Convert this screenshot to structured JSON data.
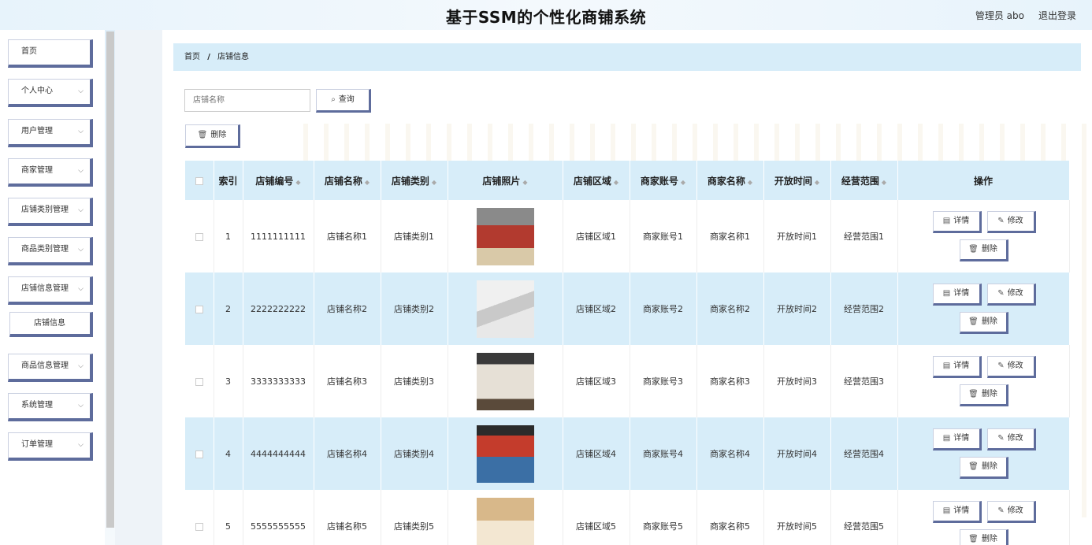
{
  "header": {
    "title": "基于SSM的个性化商铺系统",
    "user": "管理员 abo",
    "logout": "退出登录"
  },
  "sidebar": {
    "items": [
      {
        "label": "首页",
        "chevron": ""
      },
      {
        "label": "个人中心",
        "chevron": "⌵"
      },
      {
        "label": "用户管理",
        "chevron": "⌵"
      },
      {
        "label": "商家管理",
        "chevron": "⌵"
      },
      {
        "label": "店铺类别管理",
        "chevron": "⌵"
      },
      {
        "label": "商品类别管理",
        "chevron": "⌵"
      },
      {
        "label": "店铺信息管理",
        "chevron": "⌵"
      },
      {
        "label": "店铺信息",
        "chevron": ""
      },
      {
        "label": "商品信息管理",
        "chevron": "⌵"
      },
      {
        "label": "系统管理",
        "chevron": "⌵"
      },
      {
        "label": "订单管理",
        "chevron": "⌵"
      }
    ]
  },
  "breadcrumb": {
    "home": "首页",
    "sep": "/",
    "current": "店铺信息"
  },
  "search": {
    "placeholder": "店铺名称",
    "query_label": "查询",
    "query_icon": "search-icon"
  },
  "toolbar": {
    "delete_label": "删除",
    "delete_icon": "trash-icon"
  },
  "table": {
    "columns": [
      "",
      "索引",
      "店铺编号",
      "店铺名称",
      "店铺类别",
      "店铺照片",
      "店铺区域",
      "商家账号",
      "商家名称",
      "开放时间",
      "经营范围",
      "操作"
    ],
    "actions": {
      "detail": "详情",
      "edit": "修改",
      "delete": "删除"
    },
    "rows": [
      {
        "index": "1",
        "code": "1111111111",
        "name": "店铺名称1",
        "category": "店铺类别1",
        "area": "店铺区域1",
        "account": "商家账号1",
        "merchant": "商家名称1",
        "hours": "开放时间1",
        "scope": "经营范围1"
      },
      {
        "index": "2",
        "code": "2222222222",
        "name": "店铺名称2",
        "category": "店铺类别2",
        "area": "店铺区域2",
        "account": "商家账号2",
        "merchant": "商家名称2",
        "hours": "开放时间2",
        "scope": "经营范围2"
      },
      {
        "index": "3",
        "code": "3333333333",
        "name": "店铺名称3",
        "category": "店铺类别3",
        "area": "店铺区域3",
        "account": "商家账号3",
        "merchant": "商家名称3",
        "hours": "开放时间3",
        "scope": "经营范围3"
      },
      {
        "index": "4",
        "code": "4444444444",
        "name": "店铺名称4",
        "category": "店铺类别4",
        "area": "店铺区域4",
        "account": "商家账号4",
        "merchant": "商家名称4",
        "hours": "开放时间4",
        "scope": "经营范围4"
      },
      {
        "index": "5",
        "code": "5555555555",
        "name": "店铺名称5",
        "category": "店铺类别5",
        "area": "店铺区域5",
        "account": "商家账号5",
        "merchant": "商家名称5",
        "hours": "开放时间5",
        "scope": "经营范围5"
      }
    ]
  },
  "colors": {
    "accent": "#d7edf9",
    "button_shadow": "#5e6c9c"
  }
}
